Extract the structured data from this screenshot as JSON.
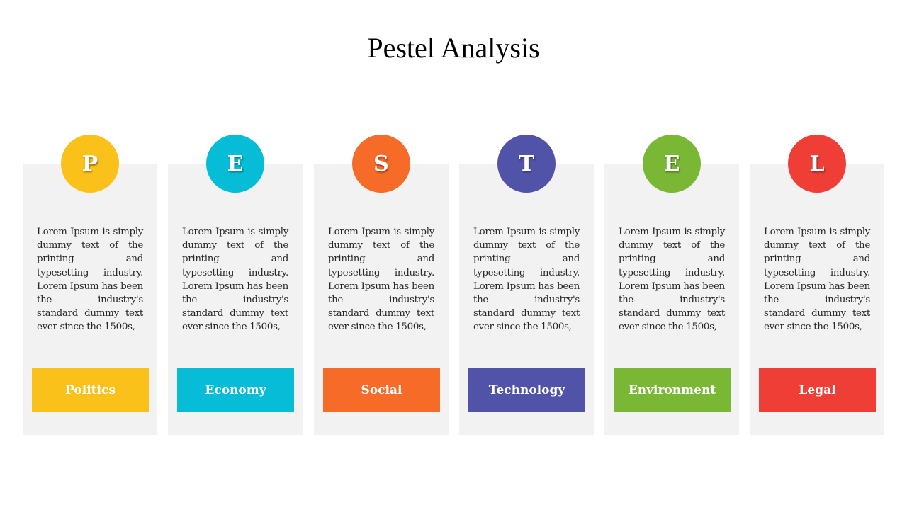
{
  "title": "Pestel Analysis",
  "cards": [
    {
      "letter": "P",
      "label": "Politics",
      "color": "#fbc11b",
      "text": "Lorem Ipsum is simply dummy text of the printing and typesetting industry. Lorem Ipsum has been the industry's standard dummy text ever since the 1500s,"
    },
    {
      "letter": "E",
      "label": "Economy",
      "color": "#06bcd6",
      "text": "Lorem Ipsum is simply dummy text of the printing and typesetting industry. Lorem Ipsum has been the industry's standard dummy text ever since the 1500s,"
    },
    {
      "letter": "S",
      "label": "Social",
      "color": "#f76b29",
      "text": "Lorem Ipsum is simply dummy text of the printing and typesetting industry. Lorem Ipsum has been the industry's standard dummy text ever since the 1500s,"
    },
    {
      "letter": "T",
      "label": "Technology",
      "color": "#5153a9",
      "text": "Lorem Ipsum is simply dummy text of the printing and typesetting industry. Lorem Ipsum has been the industry's standard dummy text ever since the 1500s,"
    },
    {
      "letter": "E",
      "label": "Environment",
      "color": "#7ab735",
      "text": "Lorem Ipsum is simply dummy text of the printing and typesetting industry. Lorem Ipsum has been the industry's standard dummy text ever since the 1500s,"
    },
    {
      "letter": "L",
      "label": "Legal",
      "color": "#ee3e36",
      "text": "Lorem Ipsum is simply dummy text of the printing and typesetting industry. Lorem Ipsum has been the industry's standard dummy text ever since the 1500s,"
    }
  ]
}
